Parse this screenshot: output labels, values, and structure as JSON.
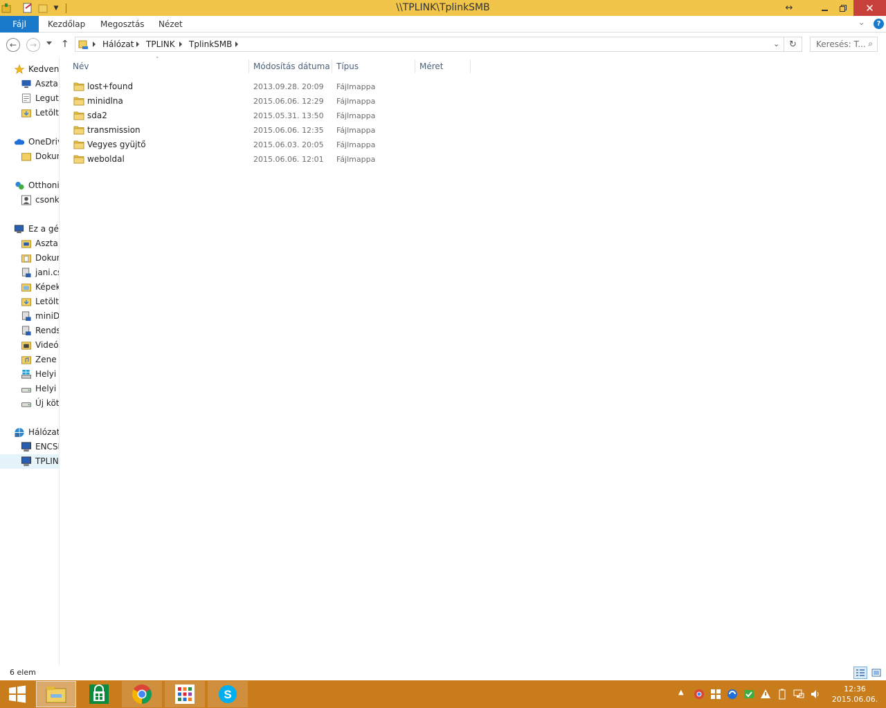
{
  "window": {
    "title": "\\\\TPLINK\\TplinkSMB"
  },
  "ribbon": {
    "file_tab": "Fájl",
    "tabs": [
      "Kezdőlap",
      "Megosztás",
      "Nézet"
    ]
  },
  "address": {
    "crumbs": [
      "Hálózat",
      "TPLINK",
      "TplinkSMB"
    ],
    "search_placeholder": "Keresés: T..."
  },
  "sidebar": {
    "items": [
      {
        "label": "Kedvenc",
        "icon": "star-icon",
        "level": 0
      },
      {
        "label": "Asztal",
        "icon": "desktop-icon",
        "level": 1
      },
      {
        "label": "Legutó",
        "icon": "recent-places-icon",
        "level": 1
      },
      {
        "label": "Letölté",
        "icon": "downloads-folder-icon",
        "level": 1
      },
      {
        "label": "OneDriv",
        "icon": "onedrive-icon",
        "level": 0
      },
      {
        "label": "Dokun",
        "icon": "folder-icon",
        "level": 1
      },
      {
        "label": "Otthoni",
        "icon": "homegroup-icon",
        "level": 0
      },
      {
        "label": "csonka",
        "icon": "user-icon",
        "level": 1
      },
      {
        "label": "Ez a gép",
        "icon": "computer-icon",
        "level": 0
      },
      {
        "label": "Asztal",
        "icon": "desktop-folder-icon",
        "level": 1
      },
      {
        "label": "Dokun",
        "icon": "documents-folder-icon",
        "level": 1
      },
      {
        "label": "jani.cs",
        "icon": "network-drive-icon",
        "level": 1
      },
      {
        "label": "Képek",
        "icon": "pictures-folder-icon",
        "level": 1
      },
      {
        "label": "Letölté",
        "icon": "downloads-folder-icon",
        "level": 1
      },
      {
        "label": "miniDl",
        "icon": "network-drive-icon",
        "level": 1
      },
      {
        "label": "Rends:",
        "icon": "network-drive-icon",
        "level": 1
      },
      {
        "label": "Videók",
        "icon": "videos-folder-icon",
        "level": 1
      },
      {
        "label": "Zene",
        "icon": "music-folder-icon",
        "level": 1
      },
      {
        "label": "Helyi l",
        "icon": "windows-drive-icon",
        "level": 1
      },
      {
        "label": "Helyi l",
        "icon": "drive-icon",
        "level": 1
      },
      {
        "label": "Új köte",
        "icon": "drive-icon",
        "level": 1
      },
      {
        "label": "Hálózat",
        "icon": "network-icon",
        "level": 0
      },
      {
        "label": "ENCSII",
        "icon": "network-computer-icon",
        "level": 1
      },
      {
        "label": "TPLINK",
        "icon": "network-computer-icon",
        "level": 1,
        "selected": true
      }
    ]
  },
  "columns": {
    "name": "Név",
    "date": "Módosítás dátuma",
    "type": "Típus",
    "size": "Méret"
  },
  "files": [
    {
      "name": "lost+found",
      "date": "2013.09.28. 20:09",
      "type": "Fájlmappa"
    },
    {
      "name": "minidlna",
      "date": "2015.06.06. 12:29",
      "type": "Fájlmappa"
    },
    {
      "name": "sda2",
      "date": "2015.05.31. 13:50",
      "type": "Fájlmappa"
    },
    {
      "name": "transmission",
      "date": "2015.06.06. 12:35",
      "type": "Fájlmappa"
    },
    {
      "name": "Vegyes gyüjtő",
      "date": "2015.06.03. 20:05",
      "type": "Fájlmappa"
    },
    {
      "name": "weboldal",
      "date": "2015.06.06. 12:01",
      "type": "Fájlmappa"
    }
  ],
  "status": {
    "count_text": "6 elem"
  },
  "clock": {
    "time": "12:36",
    "date": "2015.06.06."
  },
  "colors": {
    "titlebar": "#f0c54a",
    "file_tab": "#1979ca",
    "taskbar": "#c87c1c",
    "close": "#c7403a"
  }
}
